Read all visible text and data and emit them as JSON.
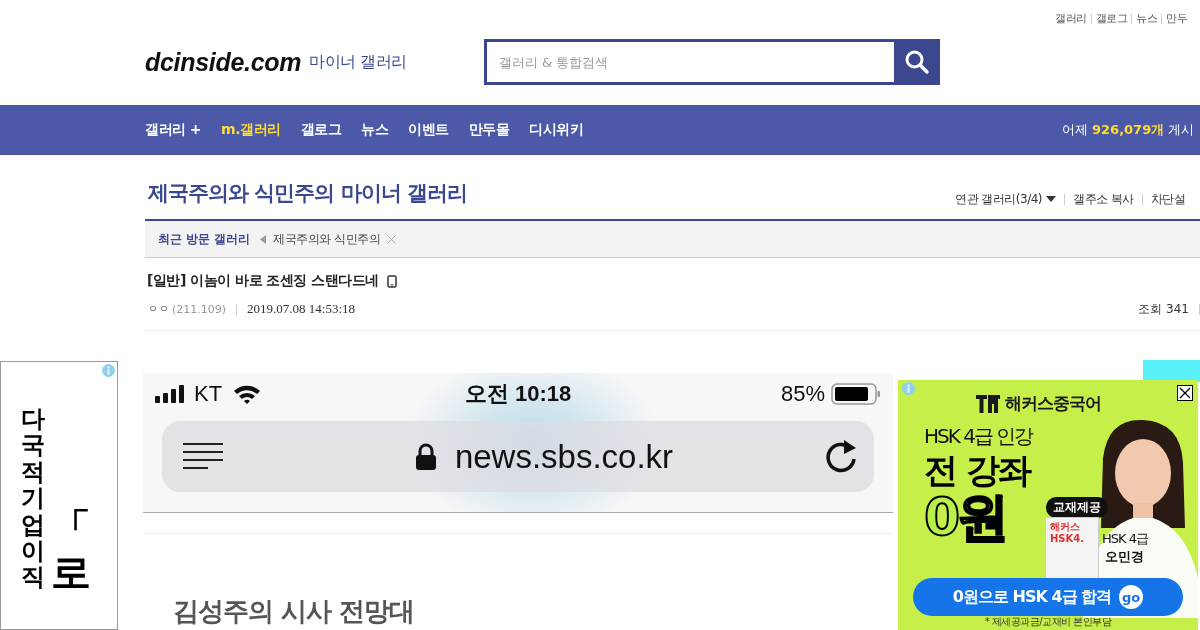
{
  "top_links": [
    "갤러리",
    "갤로그",
    "뉴스",
    "만두"
  ],
  "logo": {
    "site": "dcinside.com",
    "section": "마이너 갤러리"
  },
  "search": {
    "placeholder": "갤러리 & 통합검색"
  },
  "nav": {
    "items": [
      {
        "label": "갤러리 +",
        "highlight": false
      },
      {
        "label": "m.갤러리",
        "highlight": true
      },
      {
        "label": "갤로그",
        "highlight": false
      },
      {
        "label": "뉴스",
        "highlight": false
      },
      {
        "label": "이벤트",
        "highlight": false
      },
      {
        "label": "만두몰",
        "highlight": false
      },
      {
        "label": "디시위키",
        "highlight": false
      }
    ],
    "stats_label": "어제",
    "stats_value": "926,079개",
    "stats_suffix": "게시"
  },
  "gallery": {
    "title": "제국주의와 식민주의 마이너 갤러리",
    "links": [
      "연관 갤러리(3/4)",
      "갤주소 복사",
      "차단설"
    ]
  },
  "recent": {
    "label": "최근 방문 갤러리",
    "items": [
      "제국주의와 식민주의"
    ]
  },
  "post": {
    "title": "[일반] 이놈이 바로 조센징 스탠다드네",
    "author": "ㅇㅇ",
    "ip": "(211.109)",
    "date": "2019.07.08 14:53:18",
    "views": "조회 341"
  },
  "left_ad": {
    "column_1": "다국적 기업이직",
    "column_2": "「로"
  },
  "phone": {
    "carrier": "KT",
    "time": "오전 10:18",
    "battery": "85%",
    "url": "news.sbs.co.kr",
    "headline": "김성주의 시사 전망대"
  },
  "right_ad": {
    "brand": "해커스중국어",
    "line_1": "HSK 4급 인강",
    "line_2": "전 강좌",
    "line_3": "0원",
    "badge": "교재제공",
    "book": "해커스 HSK4.",
    "teacher_course": "HSK 4급",
    "teacher_name": "오민경",
    "cta": "0원으로 HSK 4급 합격",
    "cta_badge": "go",
    "note": "* 제세공과금/교재비 본인부담"
  }
}
